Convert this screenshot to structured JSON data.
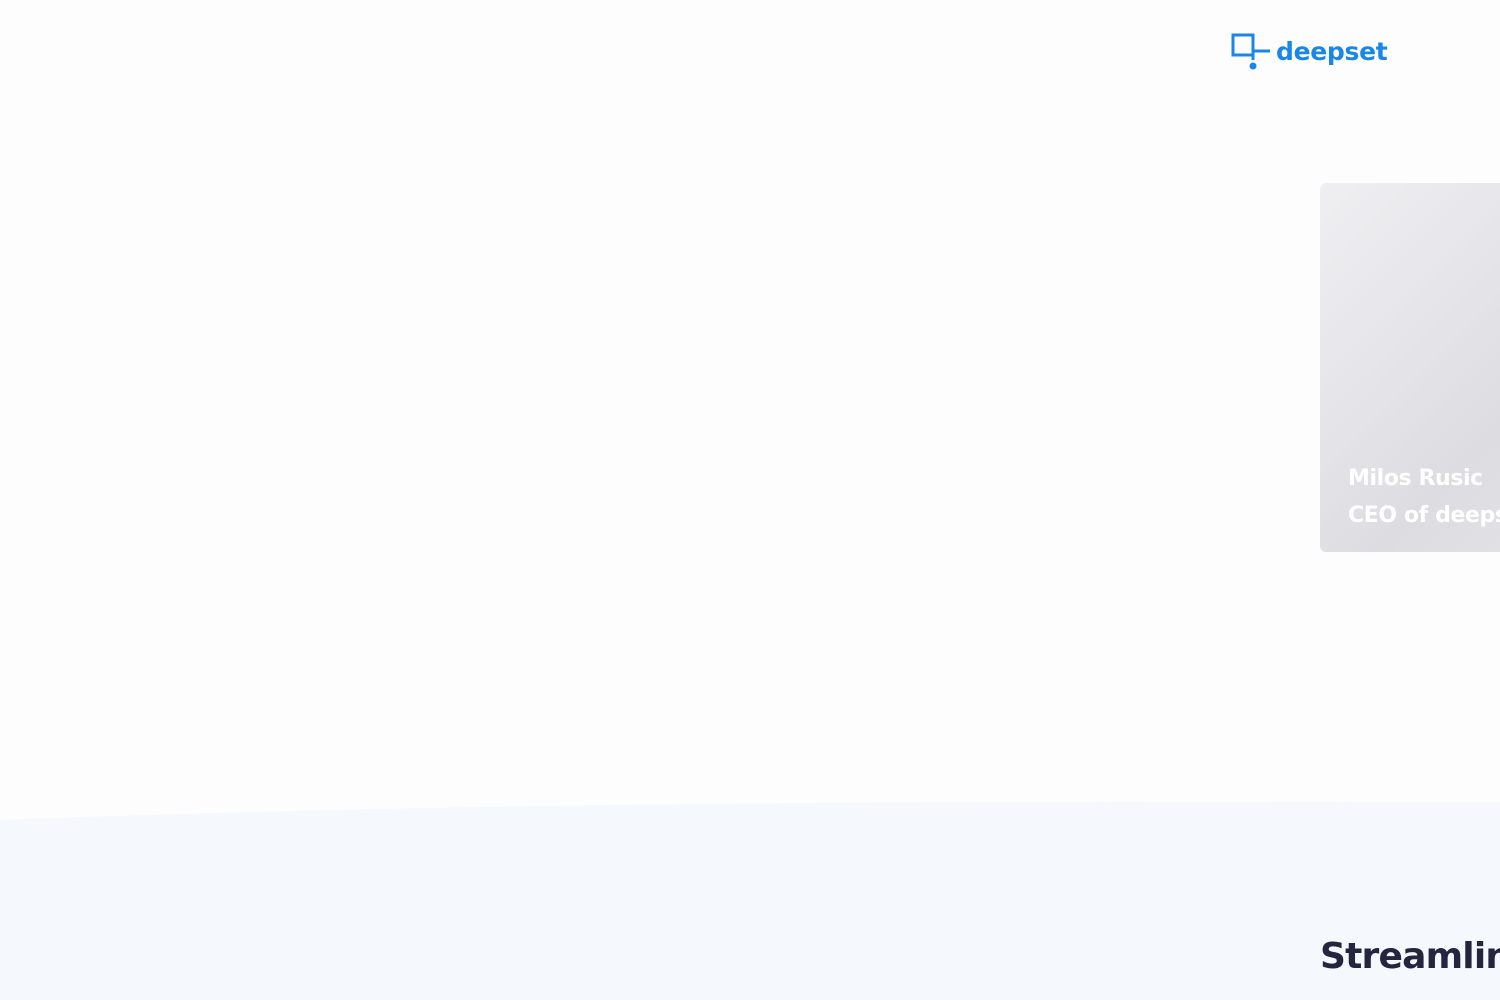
{
  "brand": {
    "name": "deepset",
    "color": "#1a86e8",
    "logo_icon": "deepset-logo-icon"
  },
  "testimonial": {
    "name": "Milos Rusic",
    "role": "CEO of deepset"
  },
  "section": {
    "heading": "Streamlining",
    "background": "#f5f8fc"
  }
}
